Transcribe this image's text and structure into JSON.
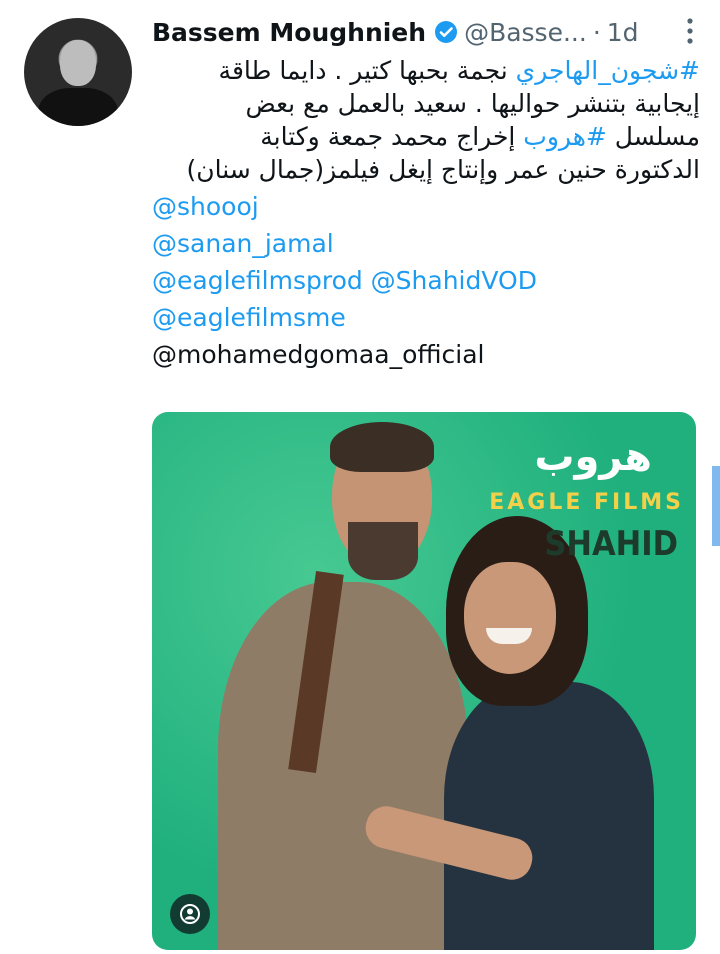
{
  "author": {
    "name": "Bassem Moughnieh",
    "handle": "@Basse...",
    "separator": "·",
    "time": "1d"
  },
  "tweet": {
    "line1_hashtag": "#شجون_الهاجري",
    "line1_text": " نجمة بحبها كتير . دايما طاقة",
    "line2": "إيجابية بتنشر حواليها . سعيد بالعمل مع بعض",
    "line3_start": "مسلسل ",
    "line3_hashtag": "#هروب",
    "line3_end": " إخراج محمد جمعة  وكتابة",
    "line4": "الدكتورة حنين عمر وإنتاج إيغل فيلمز(جمال سنان)",
    "mentions": [
      "@shoooj",
      "@sanan_jamal",
      "@eaglefilmsprod @ShahidVOD",
      "@eaglefilmsme"
    ],
    "last_mention_plain": "@mohamedgomaa_official"
  },
  "media": {
    "title_ar": "هروب",
    "brand": "EAGLE FILMS",
    "platform": "SHAHID"
  },
  "colors": {
    "link": "#1d9bf0",
    "verified": "#1d9bf0",
    "media_bg": "#1fb07e"
  },
  "icons": {
    "verified": "verified-badge-icon",
    "more": "more-vertical-icon",
    "person": "person-icon"
  }
}
